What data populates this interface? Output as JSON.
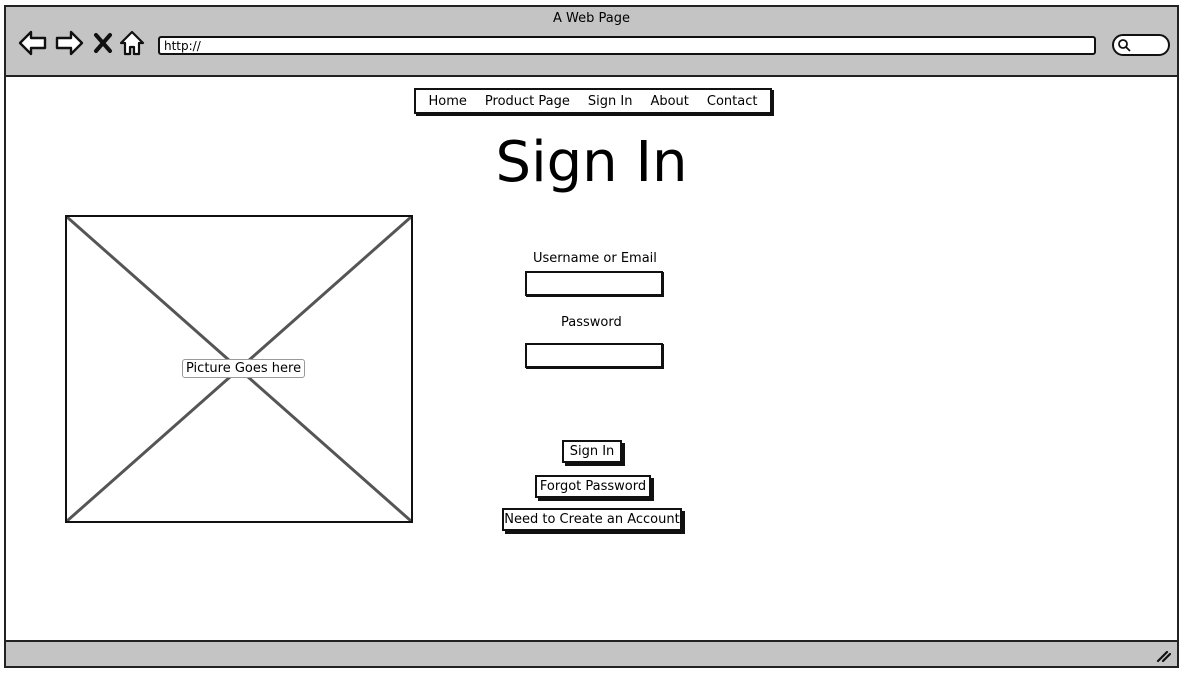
{
  "window": {
    "title": "A Web Page",
    "url": "http://"
  },
  "toolbar": {
    "back_icon": "back-arrow-icon",
    "forward_icon": "forward-arrow-icon",
    "stop_icon": "close-x-icon",
    "home_icon": "home-icon",
    "search_icon": "search-icon"
  },
  "menu": {
    "items": [
      "Home",
      "Product Page",
      "Sign In",
      "About",
      "Contact"
    ]
  },
  "page": {
    "title": "Sign In",
    "picture_label": "Picture Goes here"
  },
  "form": {
    "username_label": "Username or Email",
    "username_value": "",
    "password_label": "Password",
    "password_value": "",
    "signin_button": "Sign In",
    "forgot_button": "Forgot Password",
    "create_button": "Need to Create an Account"
  },
  "colors": {
    "chrome": "#c4c4c4",
    "ink": "#111111"
  }
}
